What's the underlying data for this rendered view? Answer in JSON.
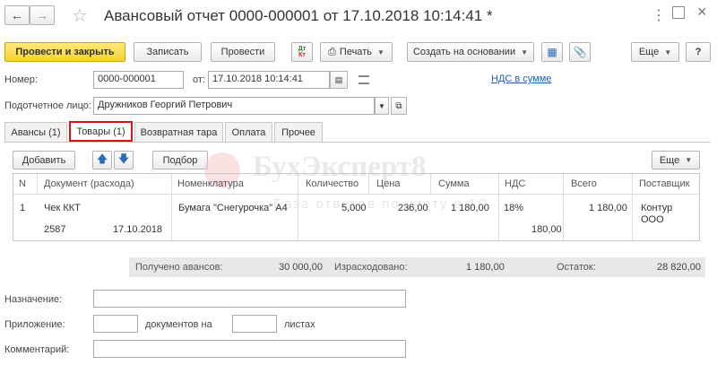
{
  "window": {
    "title": "Авансовый отчет 0000-000001 от 17.10.2018 10:14:41 *"
  },
  "toolbar": {
    "post_close": "Провести и закрыть",
    "save": "Записать",
    "post": "Провести",
    "dtkt_top": "Дт",
    "dtkt_bottom": "Кт",
    "print": "Печать",
    "create_based": "Создать на основании",
    "more": "Еще",
    "help": "?"
  },
  "header": {
    "number_label": "Номер:",
    "number_value": "0000-000001",
    "date_label": "от:",
    "date_value": "17.10.2018 10:14:41",
    "vat_link": "НДС в сумме",
    "person_label": "Подотчетное лицо:",
    "person_value": "Дружников Георгий Петрович"
  },
  "tabs": [
    {
      "label": "Авансы (1)"
    },
    {
      "label": "Товары (1)",
      "active": true
    },
    {
      "label": "Возвратная тара"
    },
    {
      "label": "Оплата"
    },
    {
      "label": "Прочее"
    }
  ],
  "table_toolbar": {
    "add": "Добавить",
    "pick": "Подбор",
    "more": "Еще"
  },
  "table": {
    "columns": [
      "N",
      "Документ (расхода)",
      "Номенклатура",
      "Количество",
      "Цена",
      "Сумма",
      "НДС",
      "Всего",
      "Поставщик"
    ],
    "rows": [
      {
        "n": "1",
        "doc": "Чек ККТ",
        "doc_number": "2587",
        "doc_date": "17.10.2018",
        "item": "Бумага \"Снегурочка\" А4",
        "qty": "5,000",
        "price": "236,00",
        "sum": "1 180,00",
        "vat_rate": "18%",
        "vat_amount": "180,00",
        "total": "1 180,00",
        "supplier_line1": "Контур",
        "supplier_line2": "ООО"
      }
    ]
  },
  "watermark": {
    "title": "БухЭксперт8",
    "subtitle": "База ответов по учету в 1С"
  },
  "totals": {
    "received_label": "Получено авансов:",
    "received_value": "30 000,00",
    "spent_label": "Израсходовано:",
    "spent_value": "1 180,00",
    "rest_label": "Остаток:",
    "rest_value": "28 820,00"
  },
  "footer": {
    "purpose_label": "Назначение:",
    "attachment_label": "Приложение:",
    "docs_on": "документов на",
    "sheets": "листах",
    "comment_label": "Комментарий:"
  },
  "colors": {
    "primary_button": "#f5d232",
    "active_tab_border": "#e01010",
    "link": "#1a5fb4",
    "totals_bg": "#e8e8e8"
  }
}
